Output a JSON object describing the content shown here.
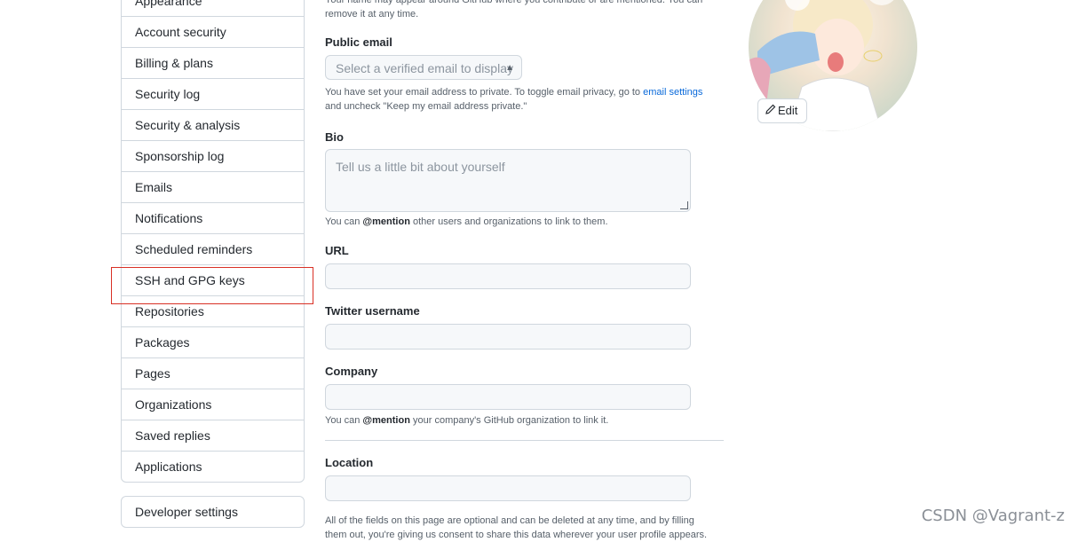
{
  "sidebar": {
    "items": [
      {
        "label": "Appearance"
      },
      {
        "label": "Account security"
      },
      {
        "label": "Billing & plans"
      },
      {
        "label": "Security log"
      },
      {
        "label": "Security & analysis"
      },
      {
        "label": "Sponsorship log"
      },
      {
        "label": "Emails"
      },
      {
        "label": "Notifications"
      },
      {
        "label": "Scheduled reminders"
      },
      {
        "label": "SSH and GPG keys"
      },
      {
        "label": "Repositories"
      },
      {
        "label": "Packages"
      },
      {
        "label": "Pages"
      },
      {
        "label": "Organizations"
      },
      {
        "label": "Saved replies"
      },
      {
        "label": "Applications"
      }
    ],
    "developer_settings": "Developer settings"
  },
  "form": {
    "name_note_line1": "Your name may appear around GitHub where you contribute or are mentioned. You can",
    "name_note_line2": "remove it at any time.",
    "public_email": {
      "label": "Public email",
      "select_value": "Select a verified email to display",
      "note_pre": "You have set your email address to private. To toggle email privacy, go to ",
      "note_link": "email settings",
      "note_post": "and uncheck \"Keep my email address private.\""
    },
    "bio": {
      "label": "Bio",
      "placeholder": "Tell us a little bit about yourself",
      "note_pre": "You can ",
      "note_mention": "@mention",
      "note_post": " other users and organizations to link to them."
    },
    "url": {
      "label": "URL",
      "value": ""
    },
    "twitter": {
      "label": "Twitter username",
      "value": ""
    },
    "company": {
      "label": "Company",
      "value": "",
      "note_pre": "You can ",
      "note_mention": "@mention",
      "note_post": " your company's GitHub organization to link it."
    },
    "location": {
      "label": "Location",
      "value": ""
    },
    "footer_line1": "All of the fields on this page are optional and can be deleted at any time, and by filling",
    "footer_line2": "them out, you're giving us consent to share this data wherever your user profile appears."
  },
  "avatar": {
    "edit_label": "Edit",
    "pencil_icon": "pencil-icon"
  },
  "watermark": "CSDN @Vagrant-z",
  "colors": {
    "highlight_box": "#d93025",
    "link": "#0969da"
  }
}
